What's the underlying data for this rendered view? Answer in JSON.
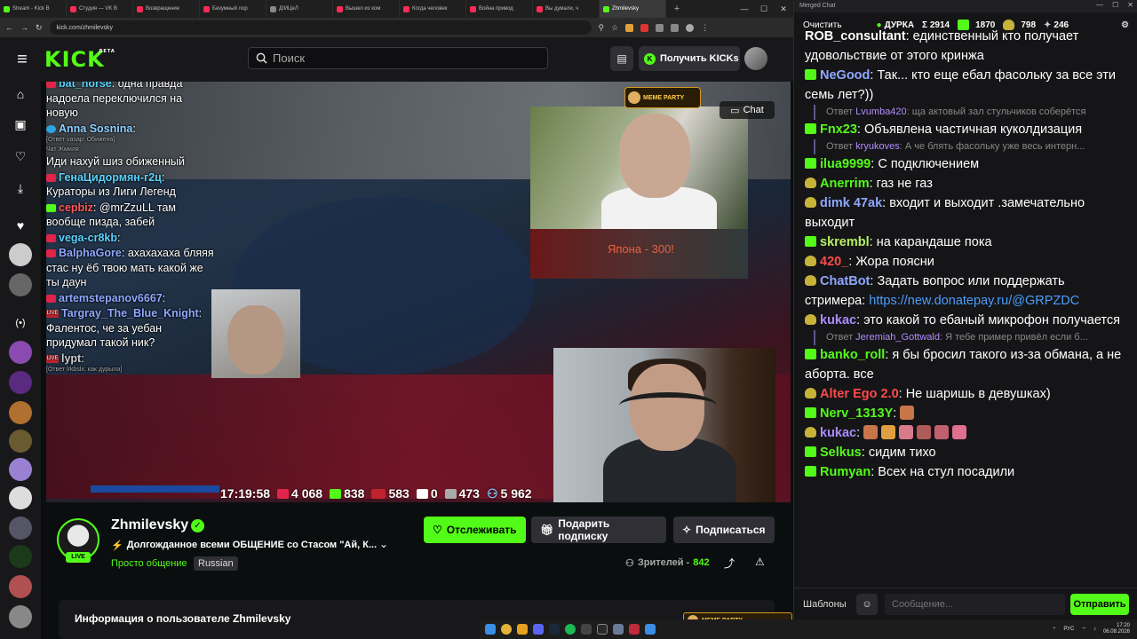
{
  "browser": {
    "tabs": [
      {
        "label": "Stream - Kick B",
        "color": "#53fc18"
      },
      {
        "label": "Студия — VK В",
        "color": "#ff2a55"
      },
      {
        "label": "Возвращение",
        "color": "#ff2a55"
      },
      {
        "label": "Безумный лор",
        "color": "#ff2a55"
      },
      {
        "label": "Д!ИЦеЛ",
        "color": "#888888"
      },
      {
        "label": "Вышел из ком",
        "color": "#ff2a55"
      },
      {
        "label": "Когда человек",
        "color": "#ff2a55"
      },
      {
        "label": "Война привод",
        "color": "#ff2a55"
      },
      {
        "label": "Вы думали, ч",
        "color": "#ff2a55"
      },
      {
        "label": "Zhmilevsky",
        "color": "#53fc18"
      }
    ],
    "url": "kick.com/zhmilevsky"
  },
  "kick": {
    "logo": "KICK",
    "logo_sup": "BETA",
    "search_placeholder": "Поиск",
    "get_kicks": "Получить KICKs"
  },
  "overlay_chat": [
    {
      "icon": "yt",
      "name": "bat_horse",
      "name_color": "#5ad3ff",
      "text": "одна правда надоела переключился на новую"
    },
    {
      "icon": "tg",
      "name": "Anna Sosnina",
      "name_color": "#8fd0ff",
      "text": "",
      "note": "[Ответ vasap: Обижена]"
    },
    {
      "icon": "",
      "name": "",
      "name_color": "#ffffff",
      "text": "Иди нахуй шиз обиженный",
      "note": "Чат Жмиля"
    },
    {
      "icon": "yt",
      "name": "ГенаЦидормян-г2ц",
      "name_color": "#5ad3ff",
      "text": "Кураторы из Лиги Легенд"
    },
    {
      "icon": "kk",
      "name": "cepbiz",
      "name_color": "#ff5a5a",
      "text": "@mrZzuLL там вообще пизда, забей"
    },
    {
      "icon": "yt",
      "name": "vega-cr8kb",
      "name_color": "#5ad3ff",
      "text": ""
    },
    {
      "icon": "yt",
      "name": "BalphaGore",
      "name_color": "#8fa8ff",
      "text": "ахахахаха бляяя стас ну ёб твою мать какой же ты даун"
    },
    {
      "icon": "yt",
      "name": "artemstepanov6667",
      "name_color": "#8fa8ff",
      "text": ""
    },
    {
      "icon": "lv",
      "name": "Targray_The_Blue_Knight",
      "name_color": "#8fa8ff",
      "text": "Фалентос, че за уебан придумал такой ник?"
    },
    {
      "icon": "lv",
      "name": "lypt",
      "name_color": "#cccccc",
      "text": "",
      "note": "[Ответ lrkbslx: как дурыла]"
    }
  ],
  "stream_overlay": {
    "clock": "17:19:58",
    "youtube": "4 068",
    "kick": "838",
    "vk": "583",
    "rutube": "0",
    "twitch": "473",
    "total": "5 962",
    "japan_label": "Япона - 300!",
    "meme_party": "MEME PARTY",
    "chat_label": "Chat"
  },
  "channel": {
    "name": "Zhmilevsky",
    "live": "LIVE",
    "title": "Долгожданное всеми ОБЩЕНИЕ со Стасом \"Ай, К...",
    "category": "Просто общение",
    "language": "Russian",
    "follow": "Отслеживать",
    "gift": "Подарить подписку",
    "subscribe": "Подписаться",
    "viewers_label": "Зрителей -",
    "viewers_count": "842",
    "about": "Информация о пользователе Zhmilevsky"
  },
  "taskbar": {
    "lang": "РУС",
    "time": "17:20",
    "date": "06.08.2026",
    "meme_counter": "MEME PARTY"
  },
  "merged_chat": {
    "window_title": "Merged Chat",
    "clear": "Очистить",
    "status": "ДУРКА",
    "sum": "Σ 2914",
    "kick_count": "1870",
    "yt_count": "798",
    "vk_count": "246",
    "messages": [
      {
        "badge": "",
        "name": "ROB_consultant",
        "name_color": "#ffffff",
        "text": "единственный кто получает удовольствие от этого кринжа"
      },
      {
        "badge": "k",
        "name": "NeGood",
        "name_color": "#8fa8ff",
        "text": "Так... кто еще ебал фасольку за все эти семь лет?))"
      },
      {
        "reply": true,
        "reply_to": "Lvumba420",
        "text": "ща актовый зал стульчиков соберётся"
      },
      {
        "badge": "k",
        "name": "Fnx23",
        "name_color": "#53fc18",
        "text": "Объявлена частичная куколдизация"
      },
      {
        "reply": true,
        "reply_to": "kryukoves",
        "text": "А че блять фасольку уже весь интерн..."
      },
      {
        "badge": "k",
        "name": "ilua9999",
        "name_color": "#53fc18",
        "text": "С подключением"
      },
      {
        "badge": "y",
        "name": "Anerrim",
        "name_color": "#53fc18",
        "text": "газ не газ"
      },
      {
        "badge": "y",
        "name": "dimk 47ak",
        "name_color": "#8fa8ff",
        "text": "входит и выходит .замечательно выходит"
      },
      {
        "badge": "k",
        "name": "skrembl",
        "name_color": "#b8f060",
        "text": "на карандаше пока"
      },
      {
        "badge": "y",
        "name": "420_",
        "name_color": "#ff4a4a",
        "text": "Жора поясни"
      },
      {
        "badge": "y",
        "name": "ChatBot",
        "name_color": "#8fa8ff",
        "text": "Задать вопрос или поддержать стримера:",
        "link": "https://new.donatepay.ru/@GRPZDC"
      },
      {
        "badge": "y",
        "name": "kukac",
        "name_color": "#a88cff",
        "text": "это какой то ебаный микрофон получается"
      },
      {
        "reply": true,
        "reply_to": "Jeremiah_Gottwald",
        "text": "Я тебе пример привёл если б..."
      },
      {
        "badge": "k",
        "name": "banko_roll",
        "name_color": "#53fc18",
        "text": "я бы бросил такого из-за обмана, а не аборта. все"
      },
      {
        "badge": "y",
        "name": "Alter Ego 2.0",
        "name_color": "#ff4a4a",
        "text": "Не шаришь в девушках)"
      },
      {
        "badge": "k",
        "name": "Nerv_1313Y",
        "name_color": "#53fc18",
        "text": ""
      },
      {
        "badge": "y",
        "name": "kukac",
        "name_color": "#a88cff",
        "text": ""
      },
      {
        "badge": "k",
        "name": "Selkus",
        "name_color": "#53fc18",
        "text": "сидим тихо"
      },
      {
        "badge": "k",
        "name": "Rumyan",
        "name_color": "#53fc18",
        "text": "Всех на стул посадили"
      }
    ],
    "templates": "Шаблоны",
    "input_placeholder": "Сообщение...",
    "send": "Отправить"
  }
}
